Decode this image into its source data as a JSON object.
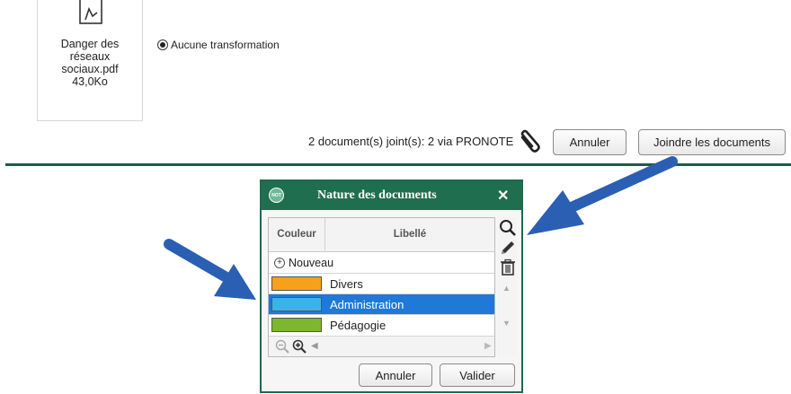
{
  "file": {
    "name": "Danger des\nréseaux\nsociaux.pdf\n43,0Ko",
    "icon": "pdf-file-icon"
  },
  "transform": {
    "option_label": "Aucune transformation"
  },
  "footer": {
    "joined_text": "2 document(s) joint(s): 2 via PRONOTE",
    "clip_icon": "paperclip-icon",
    "cancel_label": "Annuler",
    "join_label": "Joindre les documents"
  },
  "dialog": {
    "badge": "NOT",
    "title": "Nature des documents",
    "close": "✕",
    "columns": {
      "color": "Couleur",
      "label": "Libellé"
    },
    "new_label": "Nouveau",
    "rows": [
      {
        "label": "Divers",
        "color": "#f5a11c",
        "selected": false
      },
      {
        "label": "Administration",
        "color": "#3ab4e8",
        "selected": true
      },
      {
        "label": "Pédagogie",
        "color": "#7cb82f",
        "selected": false
      }
    ],
    "tools": [
      "search-icon",
      "pencil-icon",
      "trash-icon"
    ],
    "cancel_label": "Annuler",
    "validate_label": "Valider"
  },
  "colors": {
    "header_green": "#1f6e50",
    "selection_blue": "#1f79d6",
    "arrow_blue": "#2b5fb3"
  }
}
